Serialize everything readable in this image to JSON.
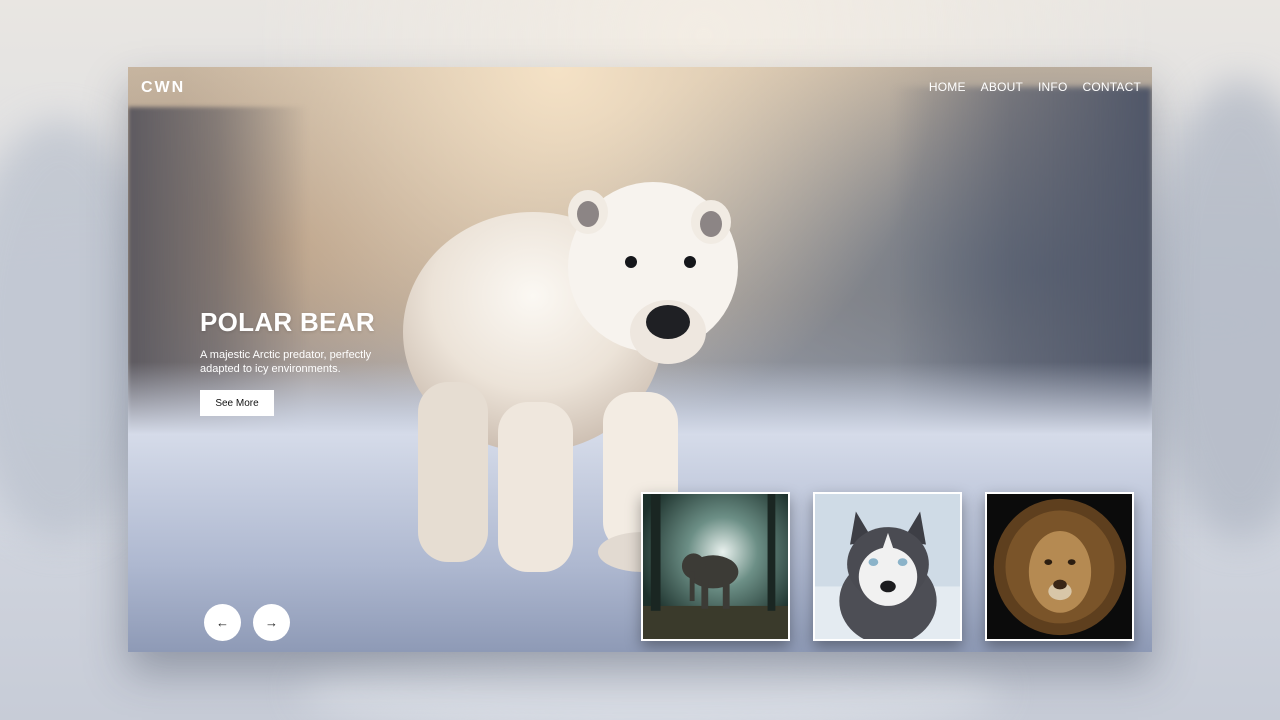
{
  "brand": {
    "logo": "CWN"
  },
  "nav": {
    "items": [
      "HOME",
      "ABOUT",
      "INFO",
      "CONTACT"
    ]
  },
  "hero": {
    "title": "POLAR BEAR",
    "description": "A majestic Arctic predator, perfectly adapted to icy environments.",
    "cta_label": "See More"
  },
  "controls": {
    "prev_icon": "arrow-left-icon",
    "next_icon": "arrow-right-icon"
  },
  "thumbnails": [
    {
      "subject": "elephant"
    },
    {
      "subject": "husky"
    },
    {
      "subject": "lion"
    }
  ],
  "colors": {
    "accent": "#ffffff",
    "text_on_dark": "#ffffff"
  }
}
